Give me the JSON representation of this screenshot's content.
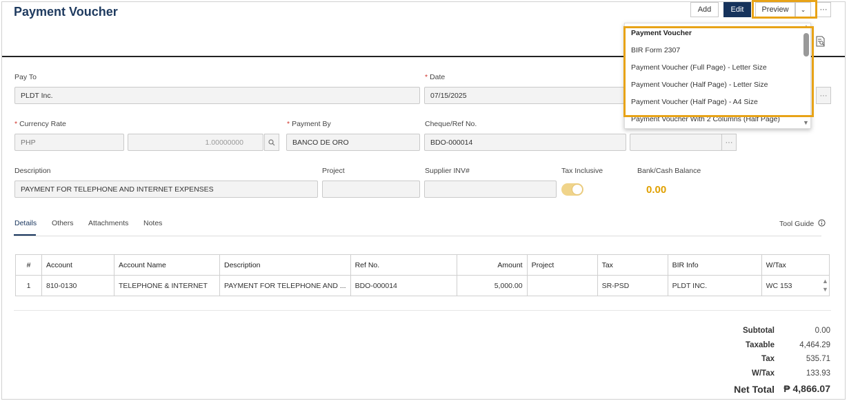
{
  "page_title": "Payment Voucher",
  "toolbar": {
    "add_label": "Add",
    "edit_label": "Edit",
    "preview_label": "Preview",
    "more_label": "···"
  },
  "dropdown": {
    "items": [
      "Payment Voucher",
      "BIR Form 2307",
      "Payment Voucher (Full Page) - Letter Size",
      "Payment Voucher (Half Page) - Letter Size",
      "Payment Voucher (Half Page) - A4 Size",
      "Payment Voucher With 2 Columns (Half Page)"
    ]
  },
  "form": {
    "pay_to_label": "Pay To",
    "pay_to_value": "PLDT Inc.",
    "date_label": "Date",
    "date_value": "07/15/2025",
    "currency_rate_label": "Currency Rate",
    "currency_value": "PHP",
    "rate_value": "1.00000000",
    "payment_by_label": "Payment By",
    "payment_by_value": "BANCO DE ORO",
    "cheque_label": "Cheque/Ref No.",
    "cheque_value": "BDO-000014",
    "description_label": "Description",
    "description_value": "PAYMENT FOR TELEPHONE AND INTERNET EXPENSES",
    "project_label": "Project",
    "supplier_inv_label": "Supplier INV#",
    "tax_inclusive_label": "Tax Inclusive",
    "tax_inclusive_on": true,
    "balance_label": "Bank/Cash Balance",
    "balance_value": "0.00",
    "required_mark": "*",
    "more_btn": "···"
  },
  "tabs": {
    "details": "Details",
    "others": "Others",
    "attachments": "Attachments",
    "notes": "Notes",
    "tool_guide": "Tool Guide"
  },
  "table": {
    "headers": [
      "#",
      "Account",
      "Account Name",
      "Description",
      "Ref No.",
      "Amount",
      "Project",
      "Tax",
      "BIR Info",
      "W/Tax"
    ],
    "rows": [
      [
        "1",
        "810-0130",
        "TELEPHONE & INTERNET",
        "PAYMENT FOR TELEPHONE AND ...",
        "BDO-000014",
        "5,000.00",
        "",
        "SR-PSD",
        "PLDT INC.",
        "WC 153"
      ]
    ]
  },
  "totals": {
    "subtotal_label": "Subtotal",
    "subtotal_value": "0.00",
    "taxable_label": "Taxable",
    "taxable_value": "4,464.29",
    "tax_label": "Tax",
    "tax_value": "535.71",
    "wtax_label": "W/Tax",
    "wtax_value": "133.93",
    "net_label": "Net Total",
    "net_value": "₱ 4,866.07"
  },
  "colors": {
    "brand": "#16335c",
    "highlight": "#e8a317",
    "balance": "#e0a000"
  },
  "icons": [
    "chevron-down-icon",
    "search-icon",
    "info-icon",
    "document-search-icon",
    "scroll-up-icon",
    "scroll-down-icon"
  ]
}
